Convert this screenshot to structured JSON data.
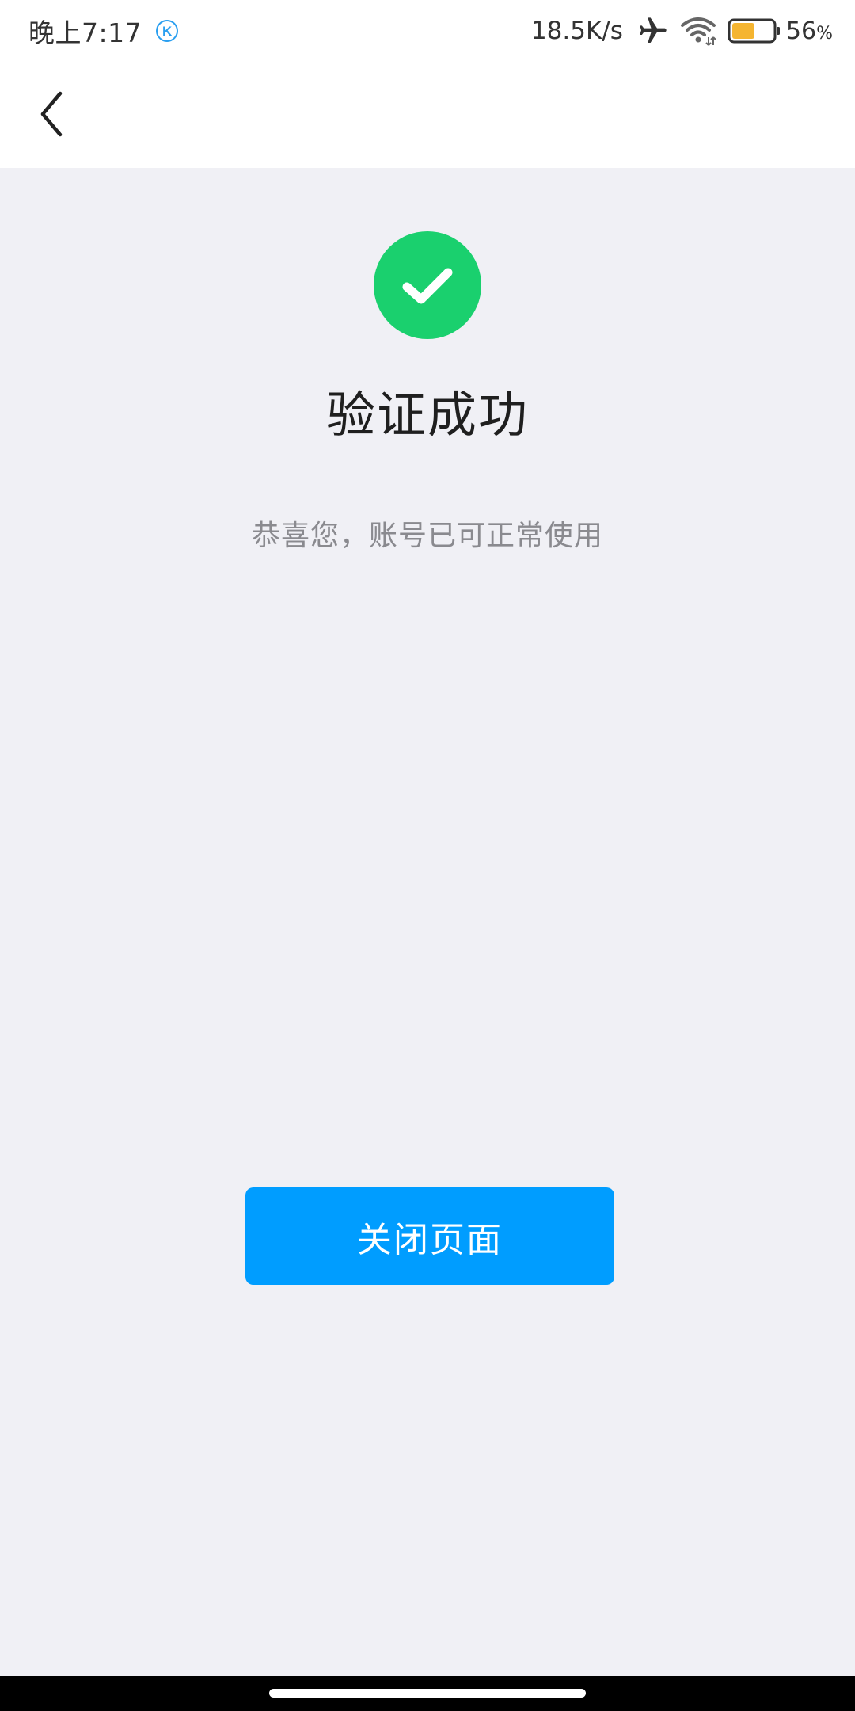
{
  "status_bar": {
    "time": "晚上7:17",
    "app_badge_letter": "K",
    "network_speed": "18.5K/s",
    "battery_percent": "56",
    "battery_percent_suffix": "%",
    "battery_level": 0.56,
    "icons": [
      "airplane-icon",
      "wifi-icon",
      "battery-icon"
    ]
  },
  "nav": {
    "back_icon": "chevron-left-icon"
  },
  "main": {
    "status_icon": "check-circle-icon",
    "title": "验证成功",
    "subtitle": "恭喜您，账号已可正常使用",
    "close_button_label": "关闭页面"
  },
  "colors": {
    "success_green": "#1ad06e",
    "primary_blue": "#009dff",
    "background": "#f0f0f5",
    "subtitle_gray": "#8a8a8f",
    "battery_fill": "#f5b531"
  }
}
